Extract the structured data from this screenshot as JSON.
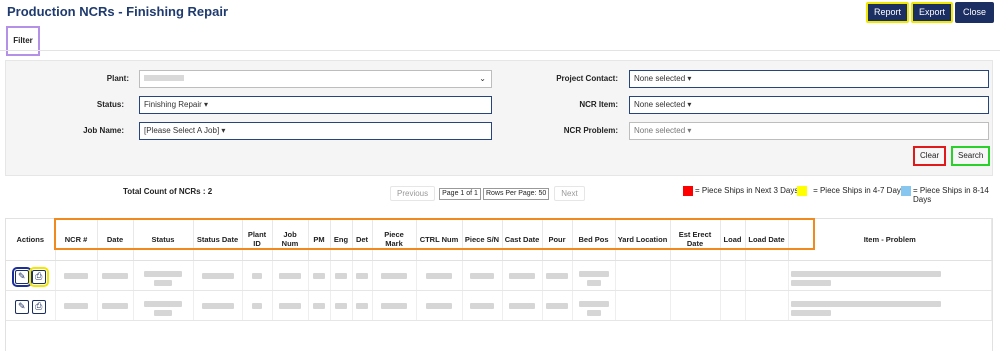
{
  "page": {
    "title": "Production NCRs - Finishing Repair"
  },
  "toolbar": {
    "report_label": "Report",
    "export_label": "Export",
    "close_label": "Close"
  },
  "filter_tab": {
    "label": "Filter"
  },
  "filters": {
    "plant": {
      "label": "Plant:"
    },
    "status": {
      "label": "Status:",
      "value": "Finishing Repair"
    },
    "job_name": {
      "label": "Job Name:",
      "value": "[Please Select A Job]"
    },
    "project_contact": {
      "label": "Project Contact:",
      "value": "None selected"
    },
    "ncr_item": {
      "label": "NCR Item:",
      "value": "None selected"
    },
    "ncr_problem": {
      "label": "NCR Problem:",
      "value": "None selected"
    },
    "clear_label": "Clear",
    "search_label": "Search"
  },
  "summary": {
    "label": "Total Count of NCRs : 2"
  },
  "pager": {
    "previous": "Previous",
    "page": "Page 1 of 1",
    "rows": "Rows Per Page: 50",
    "next": "Next"
  },
  "legend": [
    {
      "color": "#ff0000",
      "label": "= Piece Ships in Next 3 Days"
    },
    {
      "color": "#ffff00",
      "label": "= Piece Ships in 4-7 Days"
    },
    {
      "color": "#87c6ef",
      "label": "= Piece Ships in 8-14 Days"
    }
  ],
  "table": {
    "headers": [
      "Actions",
      "NCR #",
      "Date",
      "Status",
      "Status Date",
      "Plant ID",
      "Job Num",
      "PM",
      "Eng",
      "Det",
      "Piece Mark",
      "CTRL Num",
      "Piece S/N",
      "Cast Date",
      "Pour",
      "Bed Pos",
      "Yard Location",
      "Est Erect Date",
      "Load",
      "Load Date",
      "Item - Problem"
    ],
    "row_count": 2
  },
  "icons": {
    "edit": "edit-icon",
    "print": "print-icon"
  },
  "colors": {
    "primary": "#1c2f63",
    "title": "#1f3a6e"
  }
}
